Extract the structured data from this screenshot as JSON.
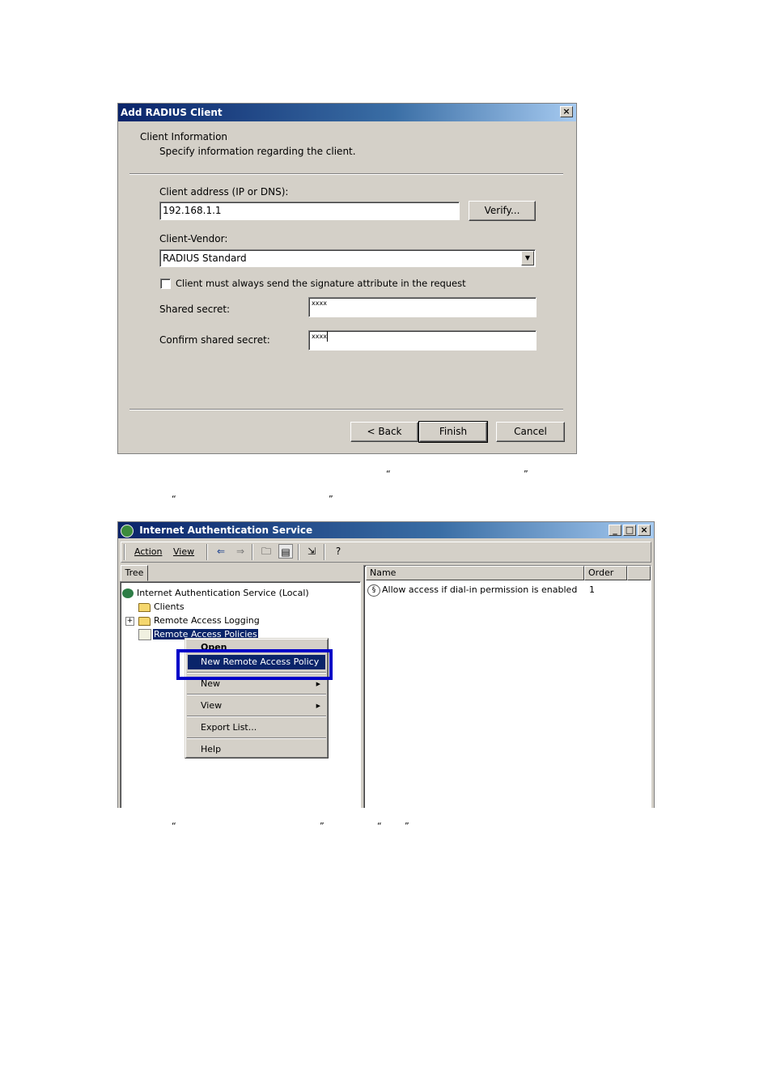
{
  "dialog": {
    "title": "Add RADIUS Client",
    "close_glyph": "×",
    "section_title": "Client Information",
    "section_desc": "Specify information regarding the client.",
    "address_label": "Client address (IP or DNS):",
    "address_value": "192.168.1.1",
    "verify_label": "Verify...",
    "vendor_label": "Client-Vendor:",
    "vendor_value": "RADIUS Standard",
    "signature_label": "Client must always send the signature attribute in the request",
    "signature_checked": false,
    "secret_label": "Shared secret:",
    "secret_value": "xxxx",
    "confirm_label": "Confirm shared secret:",
    "confirm_value": "xxxx",
    "back_label": "< Back",
    "finish_label": "Finish",
    "cancel_label": "Cancel"
  },
  "caption1": {
    "open_quote": "“",
    "close_quote": "”"
  },
  "caption2": {
    "open_quote": "“",
    "close_quote": "”"
  },
  "caption3": {
    "open_quote_a": "“",
    "close_quote_a": "”",
    "open_quote_b": "“",
    "close_quote_b": "”"
  },
  "ias": {
    "title": "Internet Authentication Service",
    "menu_action": "Action",
    "menu_view": "View",
    "tree_tab": "Tree",
    "tree": [
      {
        "label": "Internet Authentication Service (Local)",
        "icon": "server-icon"
      },
      {
        "label": "Clients",
        "icon": "folder-icon"
      },
      {
        "label": "Remote Access Logging",
        "icon": "folder-icon"
      },
      {
        "label": "Remote Access Policies",
        "icon": "policy-icon"
      }
    ],
    "columns": [
      "Name",
      "Order"
    ],
    "rows": [
      {
        "name": "Allow access if dial-in permission is enabled",
        "order": "1"
      }
    ],
    "context_menu": {
      "items": [
        "Open",
        "New Remote Access Policy",
        "New",
        "View",
        "Export List...",
        "Help"
      ],
      "highlighted": "New Remote Access Policy"
    },
    "highlight_color": "#0a246a",
    "callout_color": "#0000c8"
  }
}
